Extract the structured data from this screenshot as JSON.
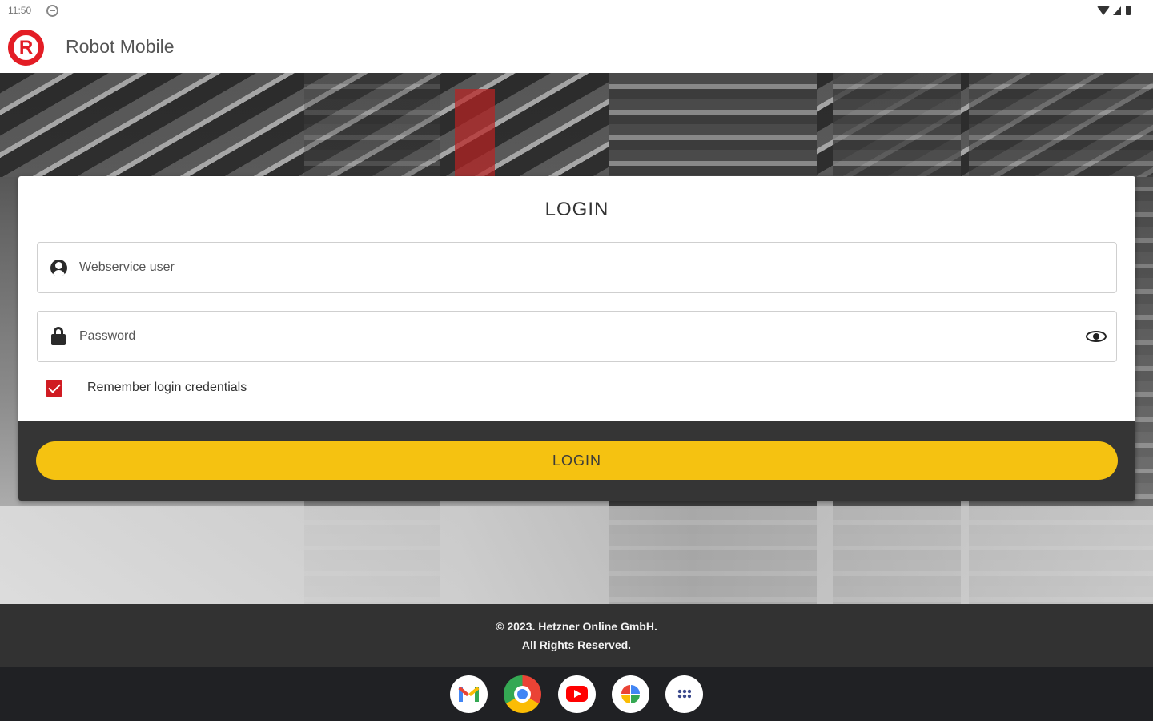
{
  "status_bar": {
    "time": "11:50"
  },
  "app_bar": {
    "logo_letter": "R",
    "title": "Robot Mobile"
  },
  "login": {
    "title": "LOGIN",
    "username_placeholder": "Webservice user",
    "username_value": "",
    "password_placeholder": "Password",
    "password_value": "",
    "remember_label": "Remember login credentials",
    "remember_checked": true,
    "button_label": "LOGIN"
  },
  "footer": {
    "line1": "© 2023. Hetzner Online GmbH.",
    "line2": "All Rights Reserved."
  },
  "colors": {
    "brand_red": "#e31d25",
    "button_yellow": "#f5c211",
    "dark_panel": "#353535"
  },
  "dock": [
    {
      "name": "Gmail",
      "icon": "gmail-icon"
    },
    {
      "name": "Chrome",
      "icon": "chrome-icon"
    },
    {
      "name": "YouTube",
      "icon": "youtube-icon"
    },
    {
      "name": "Photos",
      "icon": "photos-icon"
    },
    {
      "name": "App launcher",
      "icon": "app-launcher-icon"
    }
  ]
}
